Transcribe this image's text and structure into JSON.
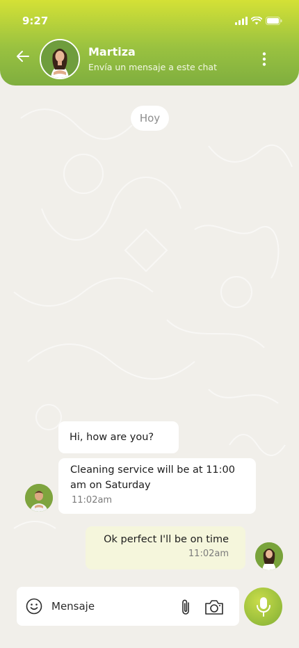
{
  "status_bar": {
    "time": "9:27"
  },
  "header": {
    "contact_name": "Martiza",
    "subtitle": "Envía un mensaje a este chat"
  },
  "chat": {
    "date_label": "Hoy",
    "messages": [
      {
        "text": "Hi, how are you?",
        "time": ""
      },
      {
        "text": "Cleaning service will be at 11:00 am on Saturday",
        "time": "11:02am"
      },
      {
        "text": "Ok perfect I'll be on time",
        "time": "11:02am"
      }
    ]
  },
  "composer": {
    "placeholder": "Mensaje"
  },
  "colors": {
    "accent_top": "#d4e136",
    "accent_bottom": "#7fae3f",
    "background": "#f1efea",
    "outgoing_bubble": "#f5f6dc"
  },
  "icons": [
    "back-arrow-icon",
    "more-vertical-icon",
    "signal-icon",
    "wifi-icon",
    "battery-icon",
    "emoji-icon",
    "paperclip-icon",
    "camera-icon",
    "microphone-icon"
  ]
}
